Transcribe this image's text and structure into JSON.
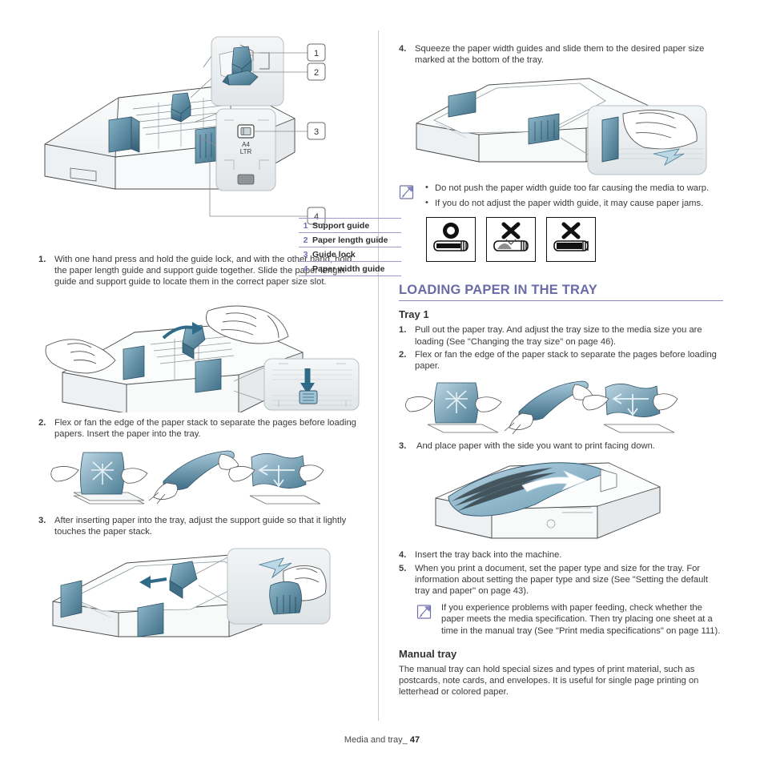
{
  "document": {
    "footer_text": "Media and tray_",
    "page_number": "47"
  },
  "left_column": {
    "legend": {
      "rows": [
        {
          "number": "1",
          "label": "Support guide"
        },
        {
          "number": "2",
          "label": "Paper length guide"
        },
        {
          "number": "3",
          "label": "Guide lock"
        },
        {
          "number": "4",
          "label": "Paper width guide"
        }
      ]
    },
    "diagram_labels": {
      "size_a4": "A4",
      "size_ltr": "LTR"
    },
    "steps": [
      {
        "number": "1.",
        "text": "With one hand press and hold the guide lock, and with the other hand, hold the paper length guide and support guide together. Slide the paper length guide and support guide to locate them in the correct paper size slot."
      },
      {
        "number": "2.",
        "text": "Flex or fan the edge of the paper stack to separate the pages before loading papers. Insert the paper into the tray."
      },
      {
        "number": "3.",
        "text": "After inserting paper into the tray, adjust the support guide so that it lightly touches the paper stack."
      }
    ]
  },
  "right_column": {
    "step4": {
      "number": "4.",
      "text": "Squeeze the paper width guides and slide them to the desired paper size marked at the bottom of the tray."
    },
    "warning_note": {
      "icon": "note-pencil-icon",
      "items": [
        "Do not push the paper width guide too far causing the media to warp.",
        "If you do not adjust the paper width guide, it may cause paper jams."
      ]
    },
    "icon_boxes": [
      {
        "mark": "circle",
        "name": "correct-loading-icon"
      },
      {
        "mark": "cross",
        "name": "incorrect-loading-warped-icon"
      },
      {
        "mark": "cross",
        "name": "incorrect-loading-overfill-icon"
      }
    ],
    "section_heading": "LOADING PAPER IN THE TRAY",
    "subheading_tray1": "Tray 1",
    "tray1_steps": [
      {
        "number": "1.",
        "text": "Pull out the paper tray. And adjust the tray size to the media size you are loading (See \"Changing the tray size\" on page 46)."
      },
      {
        "number": "2.",
        "text": "Flex or fan the edge of the paper stack to separate the pages before loading paper."
      },
      {
        "number": "3.",
        "text": "And place paper with the side you want to print facing down."
      },
      {
        "number": "4.",
        "text": "Insert the tray back into the machine."
      },
      {
        "number": "5.",
        "text": "When you print a document, set the paper type and size for the tray. For information about setting the paper type and size (See \"Setting the default tray and paper\" on page 43)."
      }
    ],
    "tip_note": {
      "icon": "note-pencil-icon",
      "text": "If you experience problems with paper feeding, check whether the paper meets the media specification. Then try placing one sheet at a time in the manual tray (See \"Print media specifications\" on page 111)."
    },
    "subheading_manual": "Manual tray",
    "manual_tray_text": "The manual tray can hold special sizes and types of print material, such as postcards, note cards, and envelopes. It is useful for single page printing on letterhead or colored paper."
  },
  "colors": {
    "accent_purple": "#6b6ba8",
    "rule_purple": "#8a8ab5",
    "body_text": "#3a3a3a",
    "guide_blue": "#5a8fa8",
    "guide_blue_dark": "#3d6e85",
    "paper_blue": "#9dc4d8"
  }
}
